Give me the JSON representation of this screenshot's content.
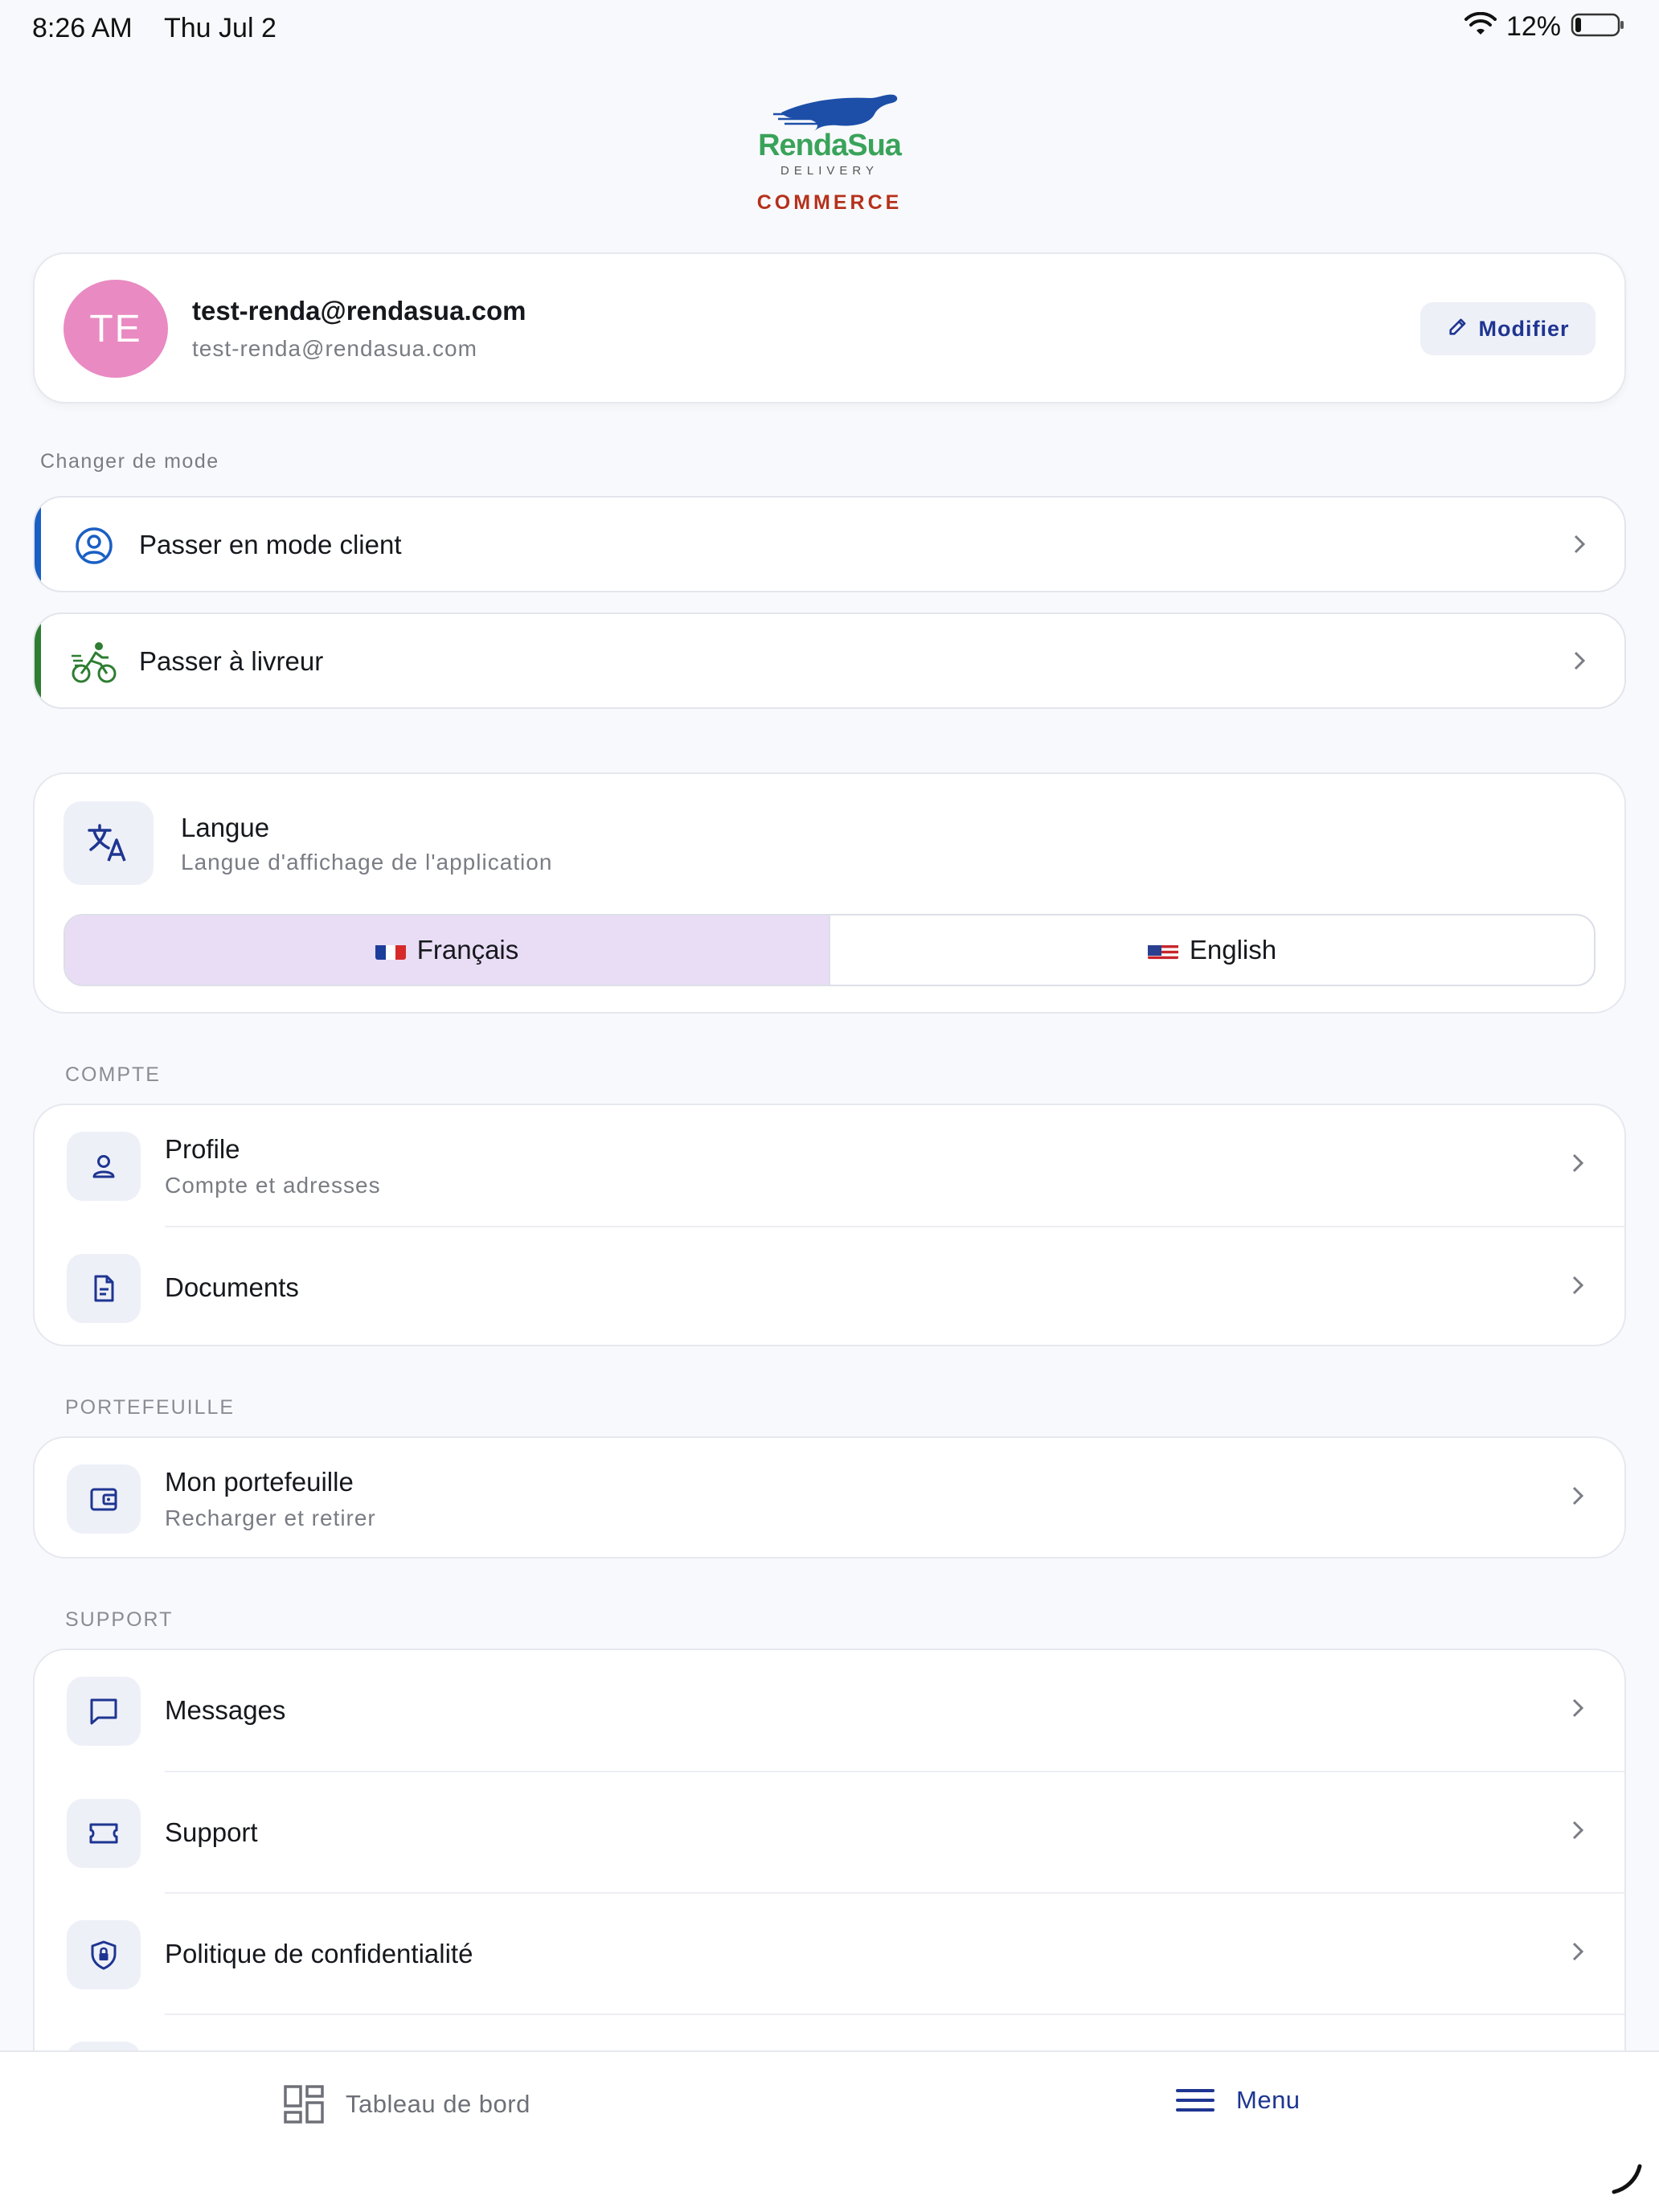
{
  "status_bar": {
    "time": "8:26 AM",
    "date": "Thu Jul 2",
    "battery": "12%"
  },
  "logo": {
    "word_renda": "Renda",
    "word_sua": "Sua",
    "subtitle": "DELIVERY",
    "tagline": "COMMERCE"
  },
  "profile": {
    "initials": "TE",
    "name": "test-renda@rendasua.com",
    "email": "test-renda@rendasua.com",
    "edit_label": "Modifier"
  },
  "mode": {
    "section_label": "Changer de mode",
    "client_label": "Passer en mode client",
    "driver_label": "Passer à livreur",
    "client_accent": "#1a5fc4",
    "driver_accent": "#2e7d32"
  },
  "language": {
    "title": "Langue",
    "subtitle": "Langue d'affichage de l'application",
    "option_fr": "Français",
    "option_en": "English"
  },
  "account": {
    "label": "COMPTE",
    "profile_title": "Profile",
    "profile_sub": "Compte et adresses",
    "documents_title": "Documents"
  },
  "wallet": {
    "label": "PORTEFEUILLE",
    "title": "Mon portefeuille",
    "sub": "Recharger et retirer"
  },
  "support": {
    "label": "SUPPORT",
    "messages": "Messages",
    "support": "Support",
    "privacy": "Politique de confidentialité"
  },
  "bottom_nav": {
    "dashboard": "Tableau de bord",
    "menu": "Menu"
  },
  "colors": {
    "primary": "#1e3591",
    "avatar": "#e98ac2",
    "brand_green": "#3aa35a",
    "commerce_red": "#b5311b"
  }
}
